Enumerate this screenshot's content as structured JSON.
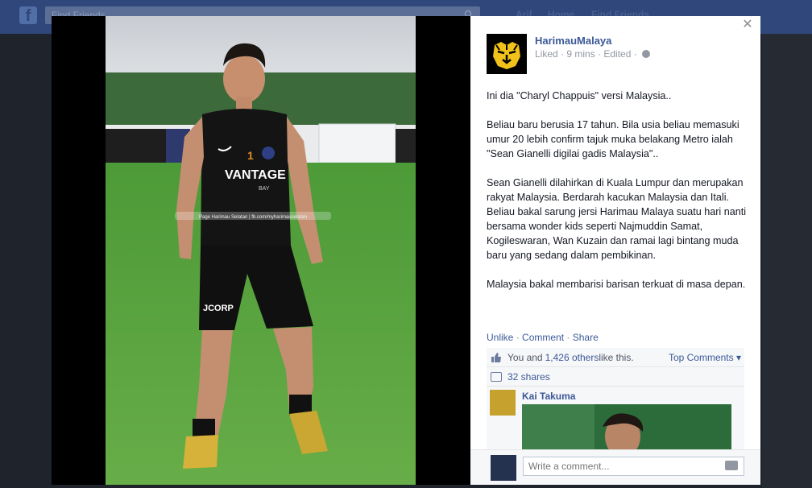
{
  "topbar": {
    "search_placeholder": "Find Friends",
    "nav": [
      "Arif",
      "Home",
      "Find Friends"
    ]
  },
  "photo": {
    "watermark": "Page Harimau Selatan | fb.com/myharimauselatan",
    "shirt_number": "1",
    "shirt_sponsor": "VANTAGE",
    "shirt_sub": "BAY",
    "shorts_logo": "JCORP"
  },
  "post": {
    "page_name": "HarimauMalaya",
    "meta": "Liked · 9 mins · Edited ·",
    "paragraphs": [
      "Ini dia \"Charyl Chappuis\" versi Malaysia..",
      "Beliau baru berusia 17 tahun. Bila usia beliau memasuki umur 20 lebih confirm tajuk muka belakang Metro ialah \"Sean Gianelli digilai gadis Malaysia\"..",
      "Sean Gianelli dilahirkan di Kuala Lumpur dan merupakan rakyat Malaysia. Berdarah kacukan Malaysia dan Itali. Beliau bakal sarung jersi Harimau Malaya suatu hari nanti bersama wonder kids seperti Najmuddin Samat, Kogileswaran, Wan Kuzain dan ramai lagi bintang muda baru yang sedang dalam pembikinan.",
      "Malaysia bakal membarisi barisan terkuat di masa depan."
    ],
    "actions": {
      "unlike": "Unlike",
      "comment": "Comment",
      "share": "Share"
    },
    "likes": {
      "prefix": "You and ",
      "link": "1,426 others",
      "suffix": " like this."
    },
    "top_comments": "Top Comments ▾",
    "shares": "32 shares",
    "comment": {
      "author": "Kai Takuma"
    },
    "write_placeholder": "Write a comment..."
  },
  "colors": {
    "link": "#3b5998",
    "topbar": "#2f477a"
  }
}
